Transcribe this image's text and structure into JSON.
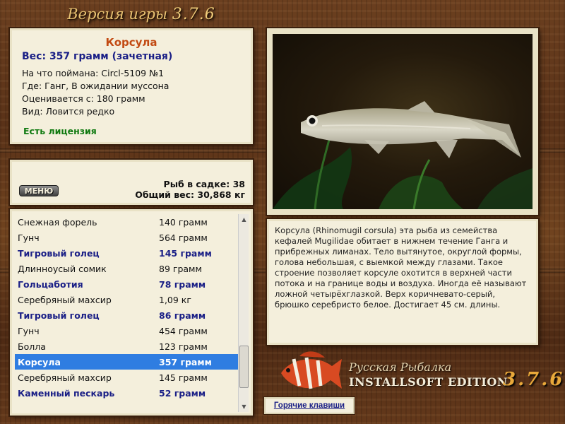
{
  "header": {
    "title": "Версия игры",
    "version": "3.7.6"
  },
  "catch_info": {
    "name": "Корсула",
    "weight": "Вес: 357 грамм (зачетная)",
    "lines": [
      "На что поймана: Circl-5109 №1",
      "Где: Ганг, В ожидании муссона",
      "Оценивается с: 180 грамм",
      "Вид: Ловится редко"
    ],
    "license": "Есть лицензия"
  },
  "stats": {
    "menu_label": "МЕНЮ",
    "fish_in_keepnet": "Рыб в садке: 38",
    "total_weight": "Общий вес: 30,868 кг"
  },
  "fish_list": [
    {
      "name": "Снежная форель",
      "weight": "140 грамм",
      "style": "normal"
    },
    {
      "name": "Гунч",
      "weight": "564 грамм",
      "style": "normal"
    },
    {
      "name": "Тигровый голец",
      "weight": "145 грамм",
      "style": "bold"
    },
    {
      "name": "Длинноусый сомик",
      "weight": "89 грамм",
      "style": "normal"
    },
    {
      "name": "Гольцаботия",
      "weight": "78 грамм",
      "style": "bold"
    },
    {
      "name": "Серебряный махсир",
      "weight": "1,09 кг",
      "style": "normal"
    },
    {
      "name": "Тигровый голец",
      "weight": "86 грамм",
      "style": "bold"
    },
    {
      "name": "Гунч",
      "weight": "454 грамм",
      "style": "normal"
    },
    {
      "name": "Болла",
      "weight": "123 грамм",
      "style": "normal"
    },
    {
      "name": "Корсула",
      "weight": "357 грамм",
      "style": "selected"
    },
    {
      "name": "Серебряный махсир",
      "weight": "145 грамм",
      "style": "normal"
    },
    {
      "name": "Каменный пескарь",
      "weight": "52 грамм",
      "style": "bold"
    }
  ],
  "description": "Корсула (Rhinomugil corsula) эта рыба из семейства кефалей Mugilidae обитает в нижнем течение Ганга и прибрежных лиманах. Тело вытянутое, округлой формы, голова небольшая, с выемкой между глазами. Такое строение позволяет корсуле охотится в верхней части потока и на границе воды и воздуха. Иногда её называют ложной четырёхглазкой. Верх коричневато-серый, брюшко серебристо белое. Достигает 45 см. длины.",
  "branding": {
    "line1": "Русская Рыбалка",
    "line2": "INSTALLSOFT EDITION",
    "version": "3.7.6"
  },
  "hotkeys_label": "Горячие клавиши",
  "colors": {
    "accent_orange": "#c24a12",
    "navy": "#1a1f86",
    "license_green": "#107a10",
    "selection": "#2f7de1"
  }
}
